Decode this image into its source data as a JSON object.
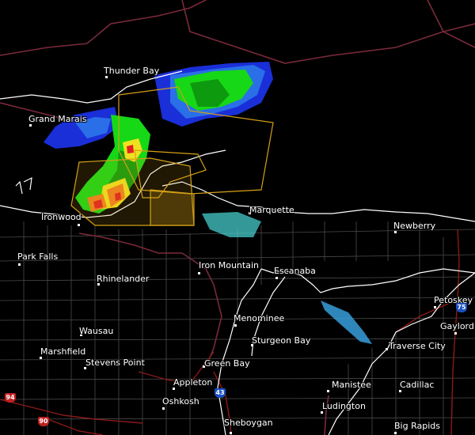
{
  "cities": [
    {
      "id": "thunder-bay",
      "name": "Thunder Bay"
    },
    {
      "id": "grand-marais",
      "name": "Grand Marais"
    },
    {
      "id": "ironwood",
      "name": "Ironwood"
    },
    {
      "id": "marquette",
      "name": "Marquette"
    },
    {
      "id": "newberry",
      "name": "Newberry"
    },
    {
      "id": "park-falls",
      "name": "Park Falls"
    },
    {
      "id": "iron-mountain",
      "name": "Iron Mountain"
    },
    {
      "id": "rhinelander",
      "name": "Rhinelander"
    },
    {
      "id": "escanaba",
      "name": "Escanaba"
    },
    {
      "id": "petoskey",
      "name": "Petoskey"
    },
    {
      "id": "menominee",
      "name": "Menominee"
    },
    {
      "id": "gaylord",
      "name": "Gaylord"
    },
    {
      "id": "wausau",
      "name": "Wausau"
    },
    {
      "id": "sturgeon-bay",
      "name": "Sturgeon Bay"
    },
    {
      "id": "traverse-city",
      "name": "Traverse City"
    },
    {
      "id": "marshfield",
      "name": "Marshfield"
    },
    {
      "id": "stevens-point",
      "name": "Stevens Point"
    },
    {
      "id": "green-bay",
      "name": "Green Bay"
    },
    {
      "id": "appleton",
      "name": "Appleton"
    },
    {
      "id": "manistee",
      "name": "Manistee"
    },
    {
      "id": "cadillac",
      "name": "Cadillac"
    },
    {
      "id": "oshkosh",
      "name": "Oshkosh"
    },
    {
      "id": "ludington",
      "name": "Ludington"
    },
    {
      "id": "sheboygan",
      "name": "Sheboygan"
    },
    {
      "id": "big-rapids",
      "name": "Big Rapids"
    }
  ],
  "shields": [
    {
      "id": "i-75",
      "label": "75",
      "color": "#1a4fc0"
    },
    {
      "id": "i-43",
      "label": "43",
      "color": "#1a4fc0"
    },
    {
      "id": "i-94",
      "label": "94",
      "color": "#c02020"
    },
    {
      "id": "i-90",
      "label": "90",
      "color": "#c02020"
    }
  ],
  "colors": {
    "background": "#000000",
    "state_border": "#6e2a3a",
    "county_line": "#555555",
    "coastline": "#ffffff",
    "warning_polygon": "#d4a017",
    "highway": "#8a1a1a"
  }
}
